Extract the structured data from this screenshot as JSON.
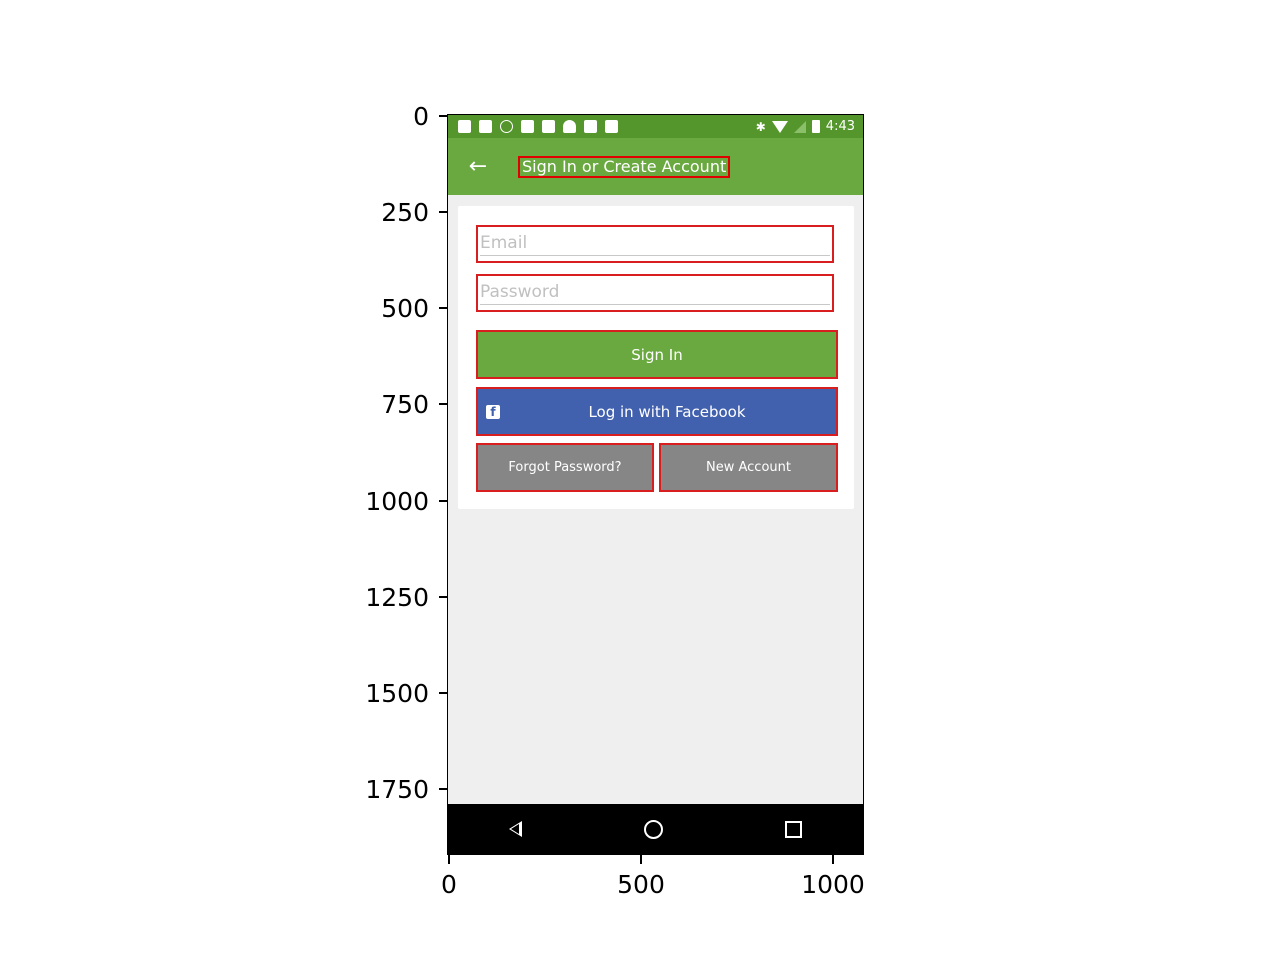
{
  "axes": {
    "y_ticks": [
      "0",
      "250",
      "500",
      "750",
      "1000",
      "1250",
      "1500",
      "1750"
    ],
    "x_ticks": [
      "0",
      "500",
      "1000"
    ]
  },
  "status_bar": {
    "time": "4:43",
    "left_icons": [
      "facebook-notification-icon",
      "facebook-notification-icon",
      "info-icon",
      "tools-icon",
      "lock-icon",
      "android-icon",
      "mail-icon",
      "briefcase-icon"
    ],
    "right_icons": [
      "bluetooth-icon",
      "wifi-icon",
      "no-signal-icon",
      "battery-icon"
    ]
  },
  "app_bar": {
    "back_icon": "arrow-left-icon",
    "title": "Sign In or Create Account",
    "color": "#6aa840"
  },
  "form": {
    "email_placeholder": "Email",
    "password_placeholder": "Password",
    "sign_in_label": "Sign In",
    "facebook_label": "Log in with Facebook",
    "forgot_label": "Forgot Password?",
    "new_account_label": "New Account"
  },
  "colors": {
    "green": "#6aa840",
    "status_green": "#55962c",
    "facebook_blue": "#4160ae",
    "gray_button": "#868686",
    "highlight_border": "#d81e1e"
  },
  "nav_bar": {
    "icons": [
      "back-triangle-icon",
      "home-circle-icon",
      "recent-square-icon"
    ]
  }
}
